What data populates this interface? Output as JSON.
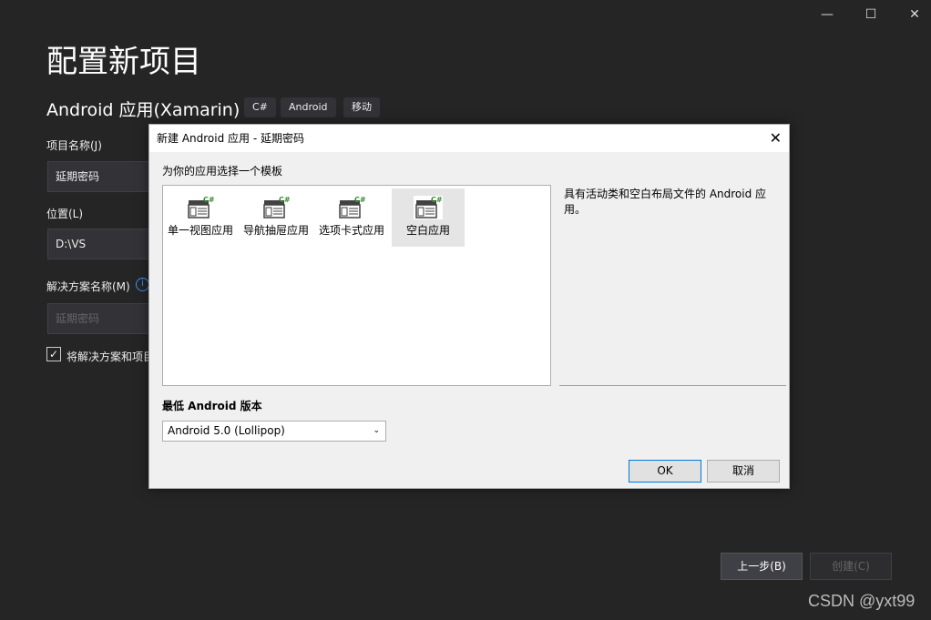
{
  "window": {
    "minimize": "—",
    "maximize": "☐",
    "close": "✕"
  },
  "page": {
    "title": "配置新项目",
    "subtitle": "Android 应用(Xamarin)",
    "tags": [
      "C#",
      "Android",
      "移动"
    ]
  },
  "form": {
    "project_name_label": "项目名称(J)",
    "project_name_value": "延期密码",
    "location_label": "位置(L)",
    "location_value": "D:\\VS",
    "solution_label": "解决方案名称(M)",
    "solution_placeholder": "延期密码",
    "checkbox_label": "将解决方案和项目放在同一目录中",
    "checkbox_checked": true
  },
  "dialog": {
    "title": "新建 Android 应用 - 延期密码",
    "prompt": "为你的应用选择一个模板",
    "templates": [
      {
        "label": "单一视图应用"
      },
      {
        "label": "导航抽屉应用"
      },
      {
        "label": "选项卡式应用"
      },
      {
        "label": "空白应用",
        "selected": true
      }
    ],
    "description": "具有活动类和空白布局文件的 Android 应用。",
    "min_version_label": "最低 Android 版本",
    "min_version_value": "Android 5.0 (Lollipop)",
    "ok": "OK",
    "cancel": "取消",
    "icon_badge": "C#"
  },
  "footer": {
    "back": "上一步(B)",
    "create": "创建(C)"
  },
  "watermark": "CSDN @yxt99"
}
